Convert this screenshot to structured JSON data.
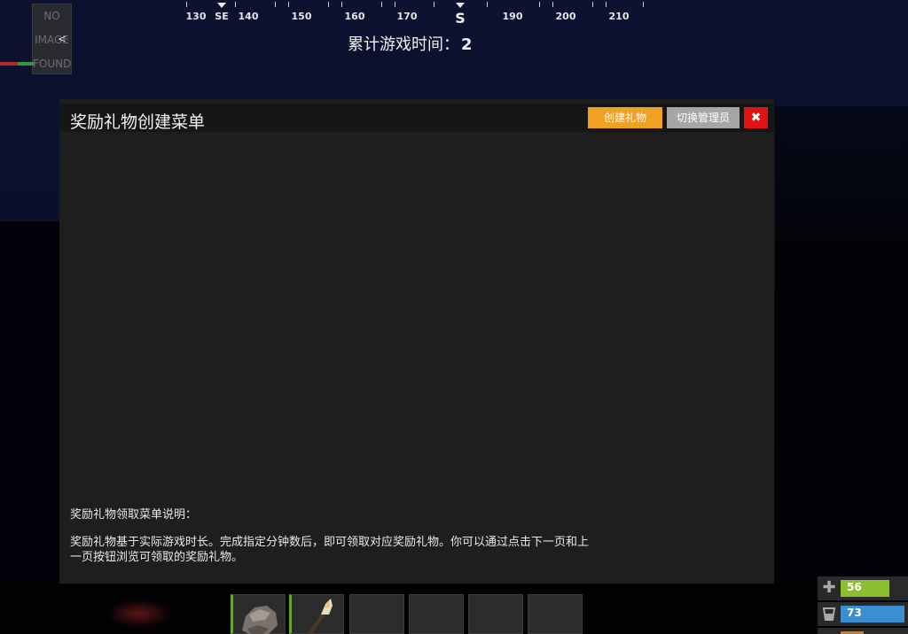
{
  "compass": {
    "labels": [
      "130",
      "SE",
      "140",
      "150",
      "160",
      "170",
      "S",
      "190",
      "200",
      "210"
    ]
  },
  "hud": {
    "playtime_label": "累计游戏时间：",
    "playtime_value": "2",
    "no_image": [
      "NO",
      "IMAGE",
      "FOUND"
    ],
    "back_arrow": "<"
  },
  "panel": {
    "title": "奖励礼物创建菜单",
    "create_button": "创建礼物",
    "switch_admin_button": "切换管理员",
    "close_button": "✖",
    "desc_title": "奖励礼物领取菜单说明：",
    "desc_body": "奖励礼物基于实际游戏时长。完成指定分钟数后，即可领取对应奖励礼物。你可以通过点击下一页和上一页按钮浏览可领取的奖励礼物。"
  },
  "hotbar": {
    "slots": [
      "rock",
      "torch",
      "",
      "",
      "",
      ""
    ]
  },
  "vitals": {
    "health": 56,
    "hydration": 73,
    "colors": {
      "health": "#8cbf2f",
      "hydration": "#3b8fd0",
      "food": "#d07a22"
    }
  },
  "colors": {
    "create_button": "#f0a023",
    "switch_button": "#a6a6a6",
    "close_button": "#e01212",
    "panel_bg": "#1e1e1e"
  }
}
